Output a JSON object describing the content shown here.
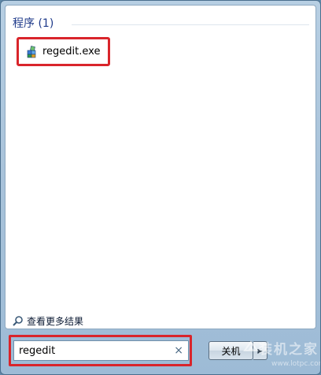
{
  "results": {
    "group_header": "程序 (1)",
    "items": [
      {
        "label": "regedit.exe",
        "icon": "regedit-icon"
      }
    ]
  },
  "see_more": {
    "label": "查看更多结果",
    "icon": "search-icon"
  },
  "search": {
    "value": "regedit",
    "clear_icon": "×"
  },
  "shutdown": {
    "label": "关机",
    "arrow": "▶"
  },
  "watermark": {
    "title": "装机之家",
    "url": "www.lotpc.com"
  },
  "colors": {
    "highlight": "#d9252b",
    "header_text": "#1e3a8a",
    "menu_bg": "#a9c3da"
  }
}
